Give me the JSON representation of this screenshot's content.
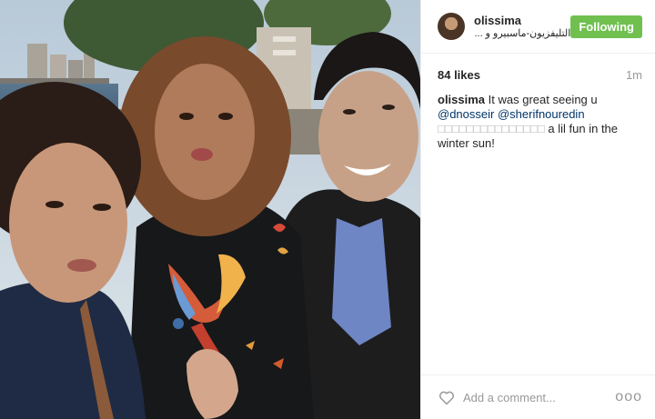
{
  "header": {
    "username": "olissima",
    "location": "التليفزيون-ماسبيرو و ...بية",
    "follow_label": "Following"
  },
  "post": {
    "likes": "84 likes",
    "time": "1m",
    "caption": {
      "username": "olissima",
      "text1": "It was great seeing u",
      "mention1": "@dnosseir",
      "mention2": "@sherifnouredin",
      "boxes": "□□□□□□□□□□□□□□□",
      "text2": "a lil fun in the winter sun!"
    }
  },
  "footer": {
    "comment_placeholder": "Add a comment...",
    "more": "ooo"
  },
  "colors": {
    "follow_button": "#70c050",
    "mention": "#003569",
    "muted": "#999999"
  },
  "icons": {
    "like": "heart-outline-icon",
    "more": "ellipsis-icon"
  }
}
